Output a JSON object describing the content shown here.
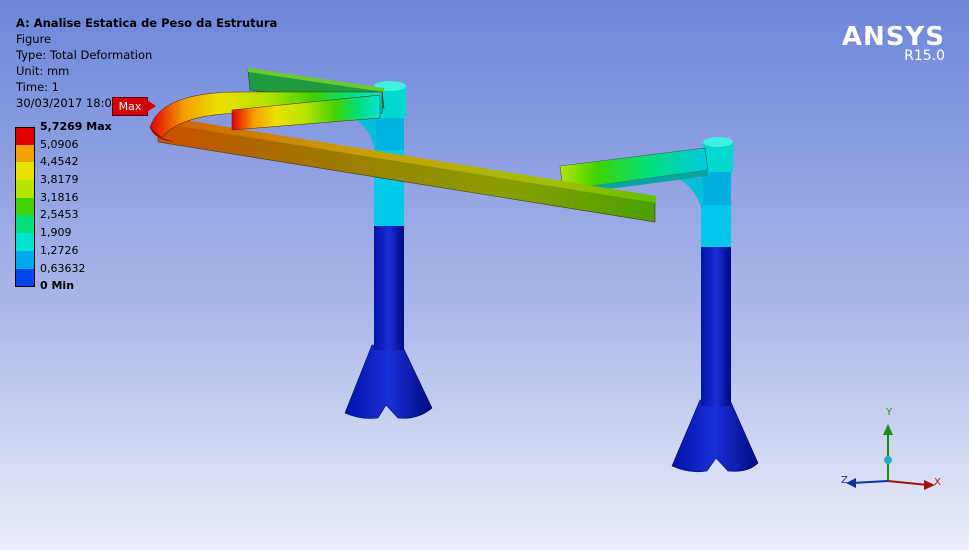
{
  "info": {
    "title": "A: Analise Estatica de Peso da Estrutura",
    "figure": "Figure",
    "type": "Type: Total Deformation",
    "unit": "Unit: mm",
    "time": "Time: 1",
    "timestamp": "30/03/2017 18:09"
  },
  "legend": [
    {
      "label": "5,7269 Max",
      "color": "#e10000",
      "bold": true
    },
    {
      "label": "5,0906",
      "color": "#f5a100",
      "bold": false
    },
    {
      "label": "4,4542",
      "color": "#e9e100",
      "bold": false
    },
    {
      "label": "3,8179",
      "color": "#b7e300",
      "bold": false
    },
    {
      "label": "3,1816",
      "color": "#3fd300",
      "bold": false
    },
    {
      "label": "2,5453",
      "color": "#00e07a",
      "bold": false
    },
    {
      "label": "1,909",
      "color": "#00e3d3",
      "bold": false
    },
    {
      "label": "1,2726",
      "color": "#00a9ee",
      "bold": false
    },
    {
      "label": "0,63632",
      "color": "#0047e5",
      "bold": false
    },
    {
      "label": "0 Min",
      "color": "#0000c8",
      "bold": true
    }
  ],
  "brand": {
    "name": "ANSYS",
    "version": "R15.0"
  },
  "probe": {
    "max_label": "Max"
  },
  "triad": {
    "x": "X",
    "y": "Y",
    "z": "Z"
  }
}
